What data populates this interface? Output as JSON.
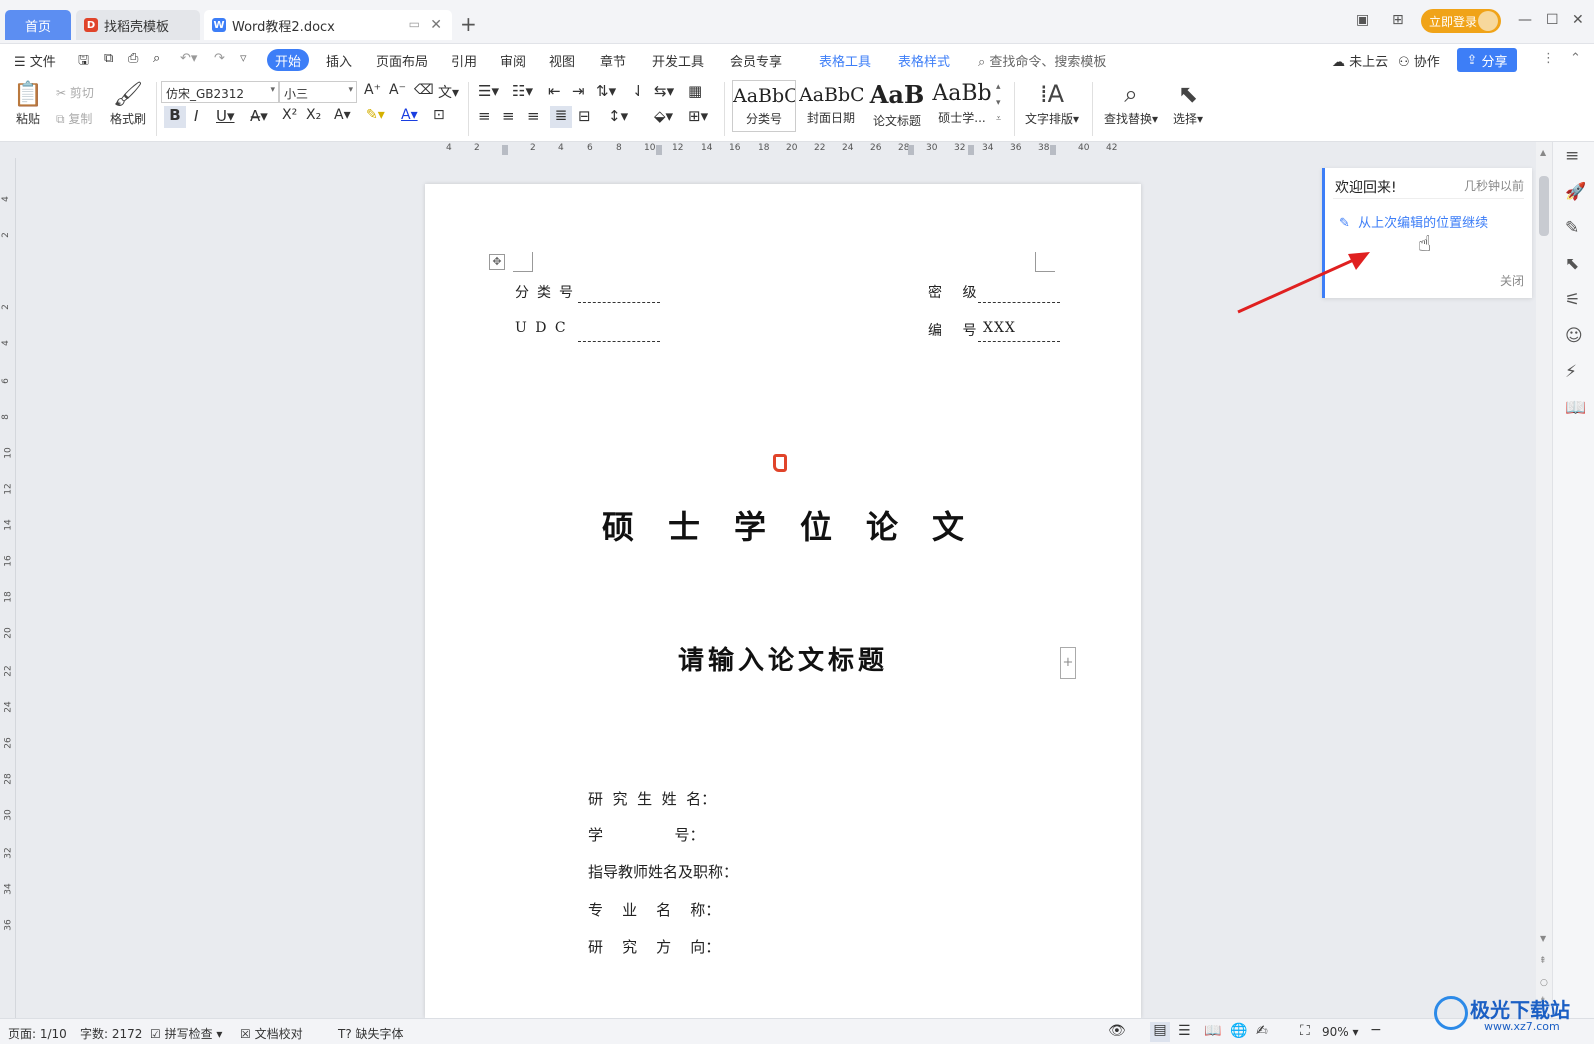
{
  "titlebar": {
    "tabs": [
      {
        "label": "首页"
      },
      {
        "label": "找稻壳模板"
      },
      {
        "label": "Word教程2.docx"
      }
    ],
    "login_label": "立即登录"
  },
  "menu": {
    "file": "文件",
    "items": [
      "开始",
      "插入",
      "页面布局",
      "引用",
      "审阅",
      "视图",
      "章节",
      "开发工具",
      "会员专享",
      "表格工具",
      "表格样式"
    ],
    "search": "查找命令、搜索模板",
    "cloud": "未上云",
    "collab": "协作",
    "share": "分享"
  },
  "ribbon": {
    "paste": "粘贴",
    "cut": "剪切",
    "copy": "复制",
    "format_painter": "格式刷",
    "font_name": "仿宋_GB2312",
    "font_size": "小三",
    "styles": [
      {
        "sample": "AaBbCcI",
        "label": "分类号"
      },
      {
        "sample": "AaBbCc",
        "label": "封面日期"
      },
      {
        "sample": "AaB",
        "label": "论文标题"
      },
      {
        "sample": "AaBb",
        "label": "硕士学..."
      }
    ],
    "text_layout": "文字排版",
    "find_replace": "查找替换",
    "select": "选择"
  },
  "ruler": {
    "h_numbers": [
      "4",
      "2",
      "2",
      "4",
      "6",
      "8",
      "10",
      "12",
      "14",
      "16",
      "18",
      "20",
      "22",
      "24",
      "26",
      "28",
      "30",
      "32",
      "34",
      "36",
      "38",
      "40",
      "42"
    ],
    "v_numbers": [
      "4",
      "2",
      "2",
      "4",
      "6",
      "8",
      "10",
      "12",
      "14",
      "16",
      "18",
      "20",
      "22",
      "24",
      "26",
      "28",
      "30",
      "32",
      "34",
      "36"
    ]
  },
  "document": {
    "class_no_label": "分类号",
    "udc_label": "U D C",
    "secret_label": "密 级",
    "serial_label": "编 号",
    "serial_value": "XXX",
    "thesis_kind": "硕士学位论文",
    "thesis_title": "请输入论文标题",
    "info_rows": [
      "研  究  生  姓  名：",
      "学               号：",
      "指导教师姓名及职称：",
      "专    业    名    称：",
      "研    究    方    向："
    ]
  },
  "welcome": {
    "title": "欢迎回来!",
    "time": "几秒钟以前",
    "link": "从上次编辑的位置继续",
    "close": "关闭"
  },
  "status": {
    "page": "页面: 1/10",
    "words": "字数: 2172",
    "spell": "拼写检查",
    "proofread": "文档校对",
    "missing_font": "缺失字体",
    "zoom": "90%"
  },
  "watermark": {
    "name": "极光下载站",
    "url": "www.xz7.com"
  },
  "colors": {
    "accent": "#3d7ef7",
    "login": "#f0a318",
    "arrow": "#e02020"
  }
}
